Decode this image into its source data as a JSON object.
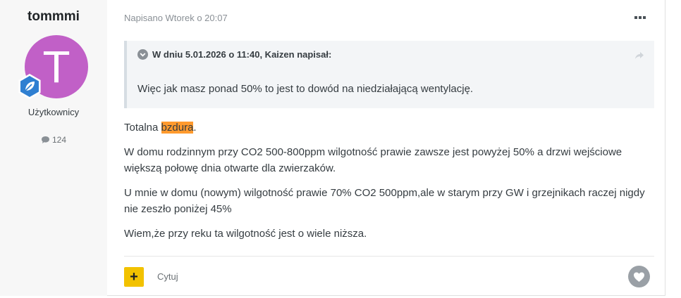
{
  "author": {
    "name": "tommmi",
    "avatar_letter": "T",
    "avatar_color": "#c160c7",
    "badge_icon": "leaf-badge-icon",
    "role": "Użytkownicy",
    "posts_count": "124"
  },
  "post": {
    "meta": "Napisano Wtorek o 20:07",
    "quote": {
      "header": "W dniu 5.01.2026 o 11:40, Kaizen napisał:",
      "body": "Więc jak masz ponad 50% to jest to dowód na niedziałającą wentylację."
    },
    "content": {
      "p1_before": "Totalna ",
      "p1_highlight": "bzdura",
      "p1_after": ".",
      "p2": "W domu rodzinnym przy CO2 500-800ppm wilgotność prawie zawsze jest powyżej 50% a drzwi wejściowe większą połowę dnia otwarte dla zwierzaków.",
      "p3": "U mnie w domu (nowym) wilgotność prawie 70% CO2 500ppm,ale w starym przy GW i grzejnikach raczej nigdy nie zeszło poniżej 45%",
      "p4": "Wiem,że przy reku ta wilgotność jest o wiele niższa."
    },
    "actions": {
      "plus_label": "+",
      "quote_label": "Cytuj"
    }
  },
  "colors": {
    "highlight": "#ff9a2e",
    "plus_button": "#f2c200"
  }
}
